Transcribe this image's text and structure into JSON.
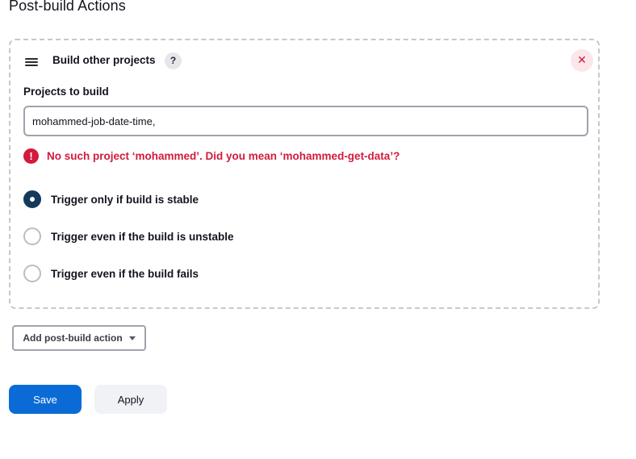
{
  "section": {
    "title": "Post-build Actions"
  },
  "build_other_projects": {
    "title": "Build other projects",
    "help_glyph": "?",
    "delete_glyph": "✕",
    "projects_label": "Projects to build",
    "projects_value": "mohammed-job-date-time,",
    "error_glyph": "!",
    "error_message": "No such project ‘mohammed’. Did you mean ‘mohammed-get-data’?",
    "trigger_options": [
      {
        "label": "Trigger only if build is stable",
        "selected": true
      },
      {
        "label": "Trigger even if the build is unstable",
        "selected": false
      },
      {
        "label": "Trigger even if the build fails",
        "selected": false
      }
    ]
  },
  "add_action": {
    "label": "Add post-build action"
  },
  "footer": {
    "save_label": "Save",
    "apply_label": "Apply"
  },
  "colors": {
    "primary": "#0b6bd6",
    "error": "#d21b3c",
    "radio_checked": "#15395b"
  }
}
